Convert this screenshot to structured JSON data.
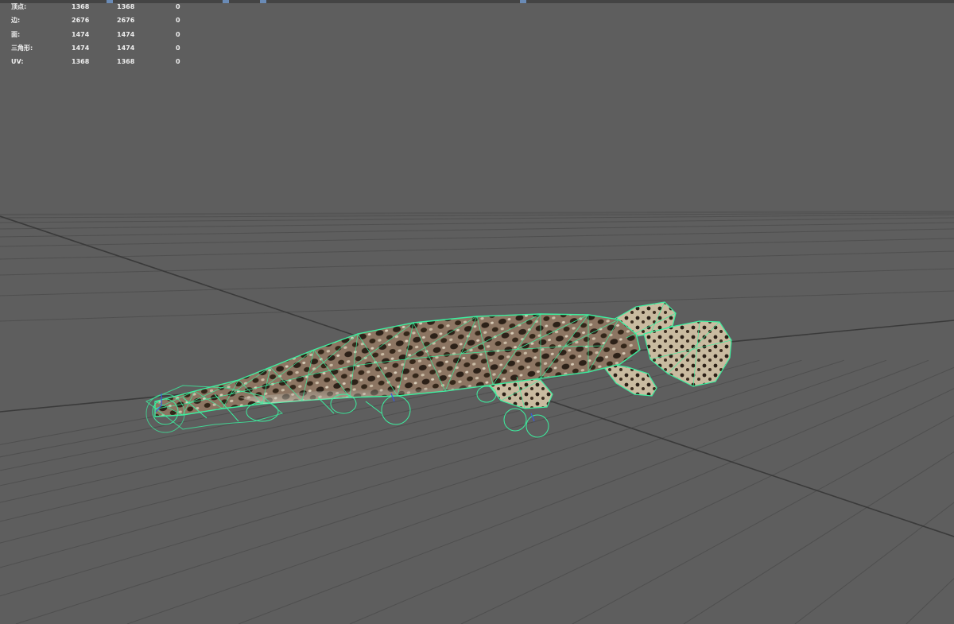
{
  "hud": {
    "rows": [
      {
        "label": "顶点:",
        "v1": "1368",
        "v2": "1368",
        "v3": "0"
      },
      {
        "label": "边:",
        "v1": "2676",
        "v2": "2676",
        "v3": "0"
      },
      {
        "label": "面:",
        "v1": "1474",
        "v2": "1474",
        "v3": "0"
      },
      {
        "label": "三角形:",
        "v1": "1474",
        "v2": "1474",
        "v3": "0"
      },
      {
        "label": "UV:",
        "v1": "1368",
        "v2": "1368",
        "v3": "0"
      }
    ]
  },
  "colors": {
    "background": "#5e5e5e",
    "grid_line": "#4f4f4f",
    "grid_axis": "#3a3a3a",
    "wireframe": "#3cf0a0",
    "hud_text": "#eeeeee",
    "model_dark": "#3b2e24",
    "model_light": "#c9bba6",
    "manipulator_blue": "#3a5ad8"
  },
  "viewport": {
    "model": "fish-mesh",
    "display_mode": "textured-wireframe",
    "grid_visible": true
  }
}
